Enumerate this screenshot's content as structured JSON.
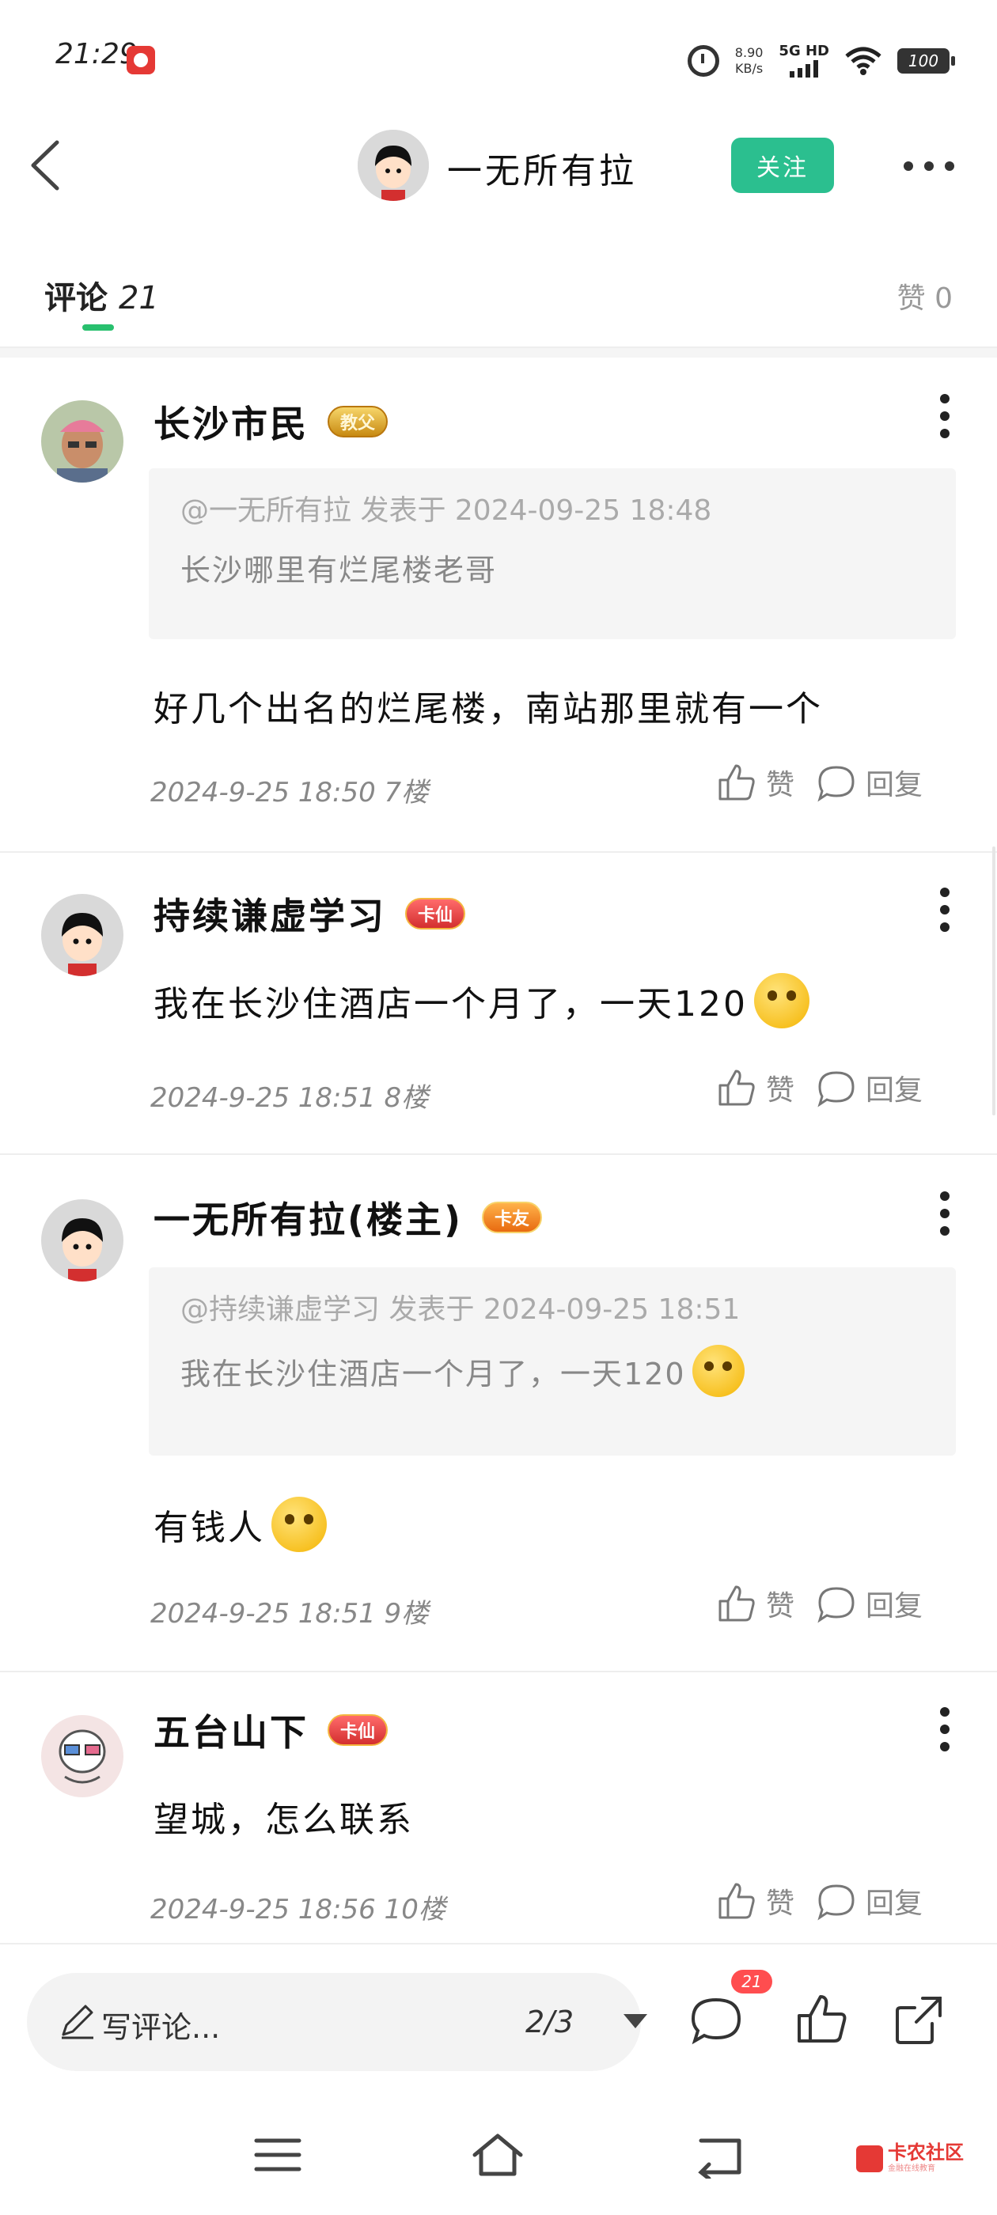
{
  "status_bar": {
    "time": "21:29",
    "net_speed_value": "8.90",
    "net_speed_unit": "KB/s",
    "network_type": "5G HD",
    "battery": "100"
  },
  "header": {
    "author_name": "一无所有拉",
    "follow_label": "关注"
  },
  "tabs": {
    "comments_label": "评论",
    "comments_count": "21",
    "likes_label": "赞 0"
  },
  "comments": [
    {
      "name": "长沙市民",
      "badge": "教父",
      "quote_meta": "@一无所有拉 发表于 2024-09-25 18:48",
      "quote_text": "长沙哪里有烂尾楼老哥",
      "body": "好几个出名的烂尾楼，南站那里就有一个",
      "meta": "2024-9-25 18:50  7楼",
      "like_label": "赞",
      "reply_label": "回复"
    },
    {
      "name": "持续谦虚学习",
      "badge": "卡仙",
      "body": "我在长沙住酒店一个月了，一天120",
      "meta": "2024-9-25 18:51  8楼",
      "like_label": "赞",
      "reply_label": "回复"
    },
    {
      "name": "一无所有拉(楼主)",
      "badge": "卡友",
      "quote_meta": "@持续谦虚学习 发表于 2024-09-25 18:51",
      "quote_text": "我在长沙住酒店一个月了，一天120",
      "body": "有钱人",
      "meta": "2024-9-25 18:51  9楼",
      "like_label": "赞",
      "reply_label": "回复"
    },
    {
      "name": "五台山下",
      "badge": "卡仙",
      "body": "望城，怎么联系",
      "meta": "2024-9-25 18:56  10楼",
      "like_label": "赞",
      "reply_label": "回复"
    }
  ],
  "bottom_bar": {
    "write_placeholder": "写评论...",
    "page_indicator": "2/3",
    "comment_count": "21"
  },
  "nav_bar": {
    "watermark_text": "卡农社区",
    "watermark_sub": "金融在线教育"
  },
  "colors": {
    "accent_green": "#2bbf8f",
    "tab_indicator": "#28c06e",
    "notification_red": "#ff4d4f"
  }
}
